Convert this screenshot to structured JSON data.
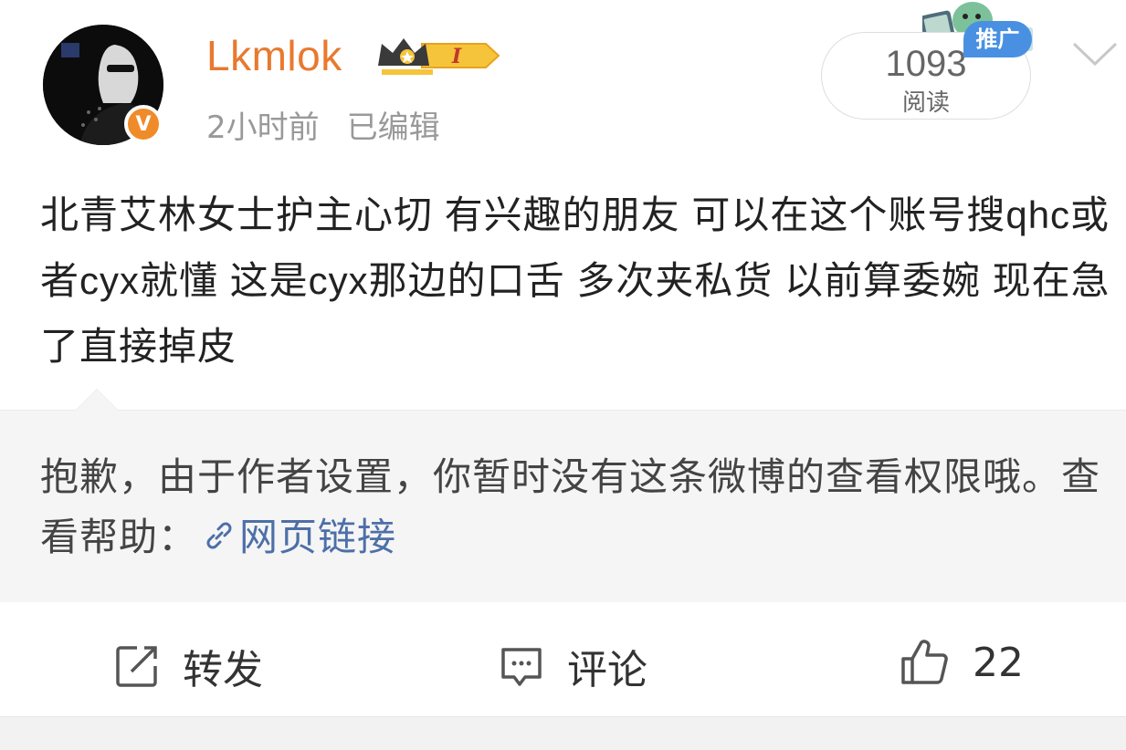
{
  "header": {
    "username": "Lkmlok",
    "level_badge": "I",
    "time": "2小时前",
    "edited": "已编辑",
    "read_count": "1093",
    "read_label": "阅读",
    "promo_tag": "推广",
    "verified_mark": "V"
  },
  "post": {
    "text": "北青艾林女士护主心切 有兴趣的朋友 可以在这个账号搜qhc或者cyx就懂 这是cyx那边的口舌 多次夹私货 以前算委婉 现在急了直接掉皮"
  },
  "notice": {
    "text": "抱歉，由于作者设置，你暂时没有这条微博的查看权限哦。查看帮助：",
    "link_label": "网页链接"
  },
  "actions": {
    "repost_label": "转发",
    "comment_label": "评论",
    "like_count": "22"
  },
  "colors": {
    "username": "#e8792f",
    "verified": "#f08b2a",
    "promo": "#4a90e2",
    "link": "#4d6fa8"
  }
}
